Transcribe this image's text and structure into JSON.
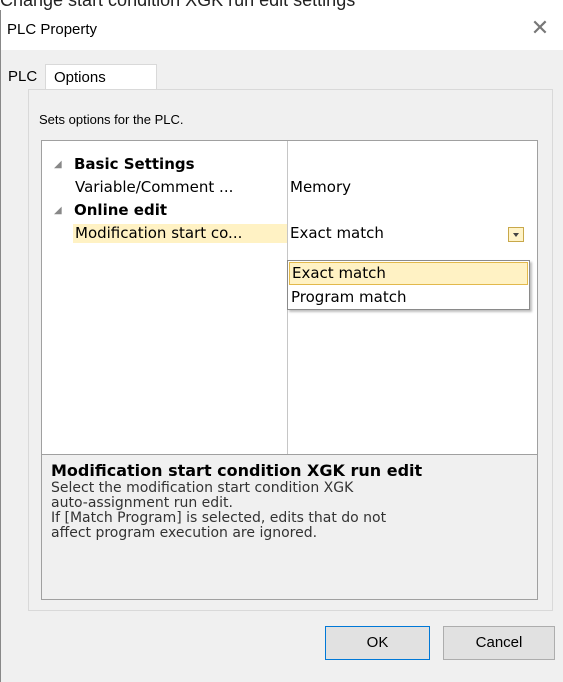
{
  "top_caption": "Change start condition XGK run edit settings",
  "dialog": {
    "title": "PLC Property",
    "close_label": "✕"
  },
  "tabs": [
    {
      "label": "PLC",
      "active": false
    },
    {
      "label": "Options",
      "active": true
    }
  ],
  "description": "Sets options for the PLC.",
  "grid": {
    "categories": [
      {
        "label": "Basic Settings",
        "expanded": true,
        "toggle_glyph": "◢"
      },
      {
        "label": "Online edit",
        "expanded": true,
        "toggle_glyph": "◢"
      }
    ],
    "rows": [
      {
        "name": "Variable/Comment ...",
        "value": "Memory"
      },
      {
        "name": "Modification start co...",
        "value": "Exact match",
        "selected": true
      }
    ],
    "dropdown_icon": "chevron-down-icon",
    "dropdown_options": [
      {
        "label": "Exact match",
        "highlighted": true
      },
      {
        "label": "Program match",
        "highlighted": false
      }
    ]
  },
  "help": {
    "title": "Modification start condition XGK run edit",
    "line1": "Select the modification start condition XGK",
    "line2": "auto-assignment run edit.",
    "line3": "If [Match Program] is selected, edits that do not",
    "line4": "affect program execution are ignored."
  },
  "buttons": {
    "ok": "OK",
    "cancel": "Cancel"
  },
  "colors": {
    "selection": "#fff2c4",
    "highlight_border": "#e2b94c",
    "ok_border": "#0078d7"
  }
}
